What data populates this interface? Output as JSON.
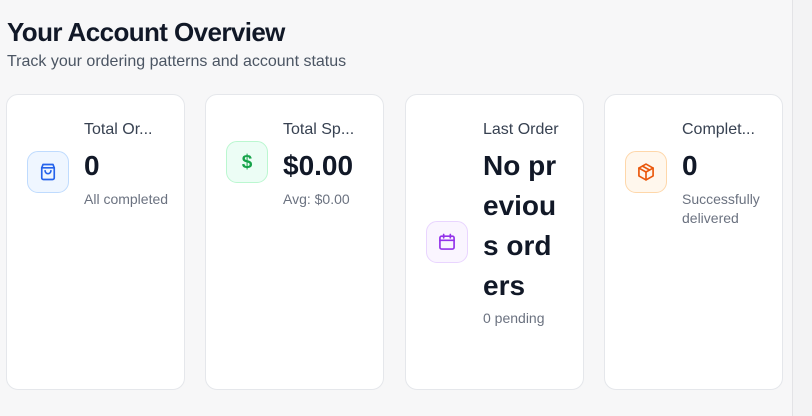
{
  "header": {
    "title": "Your Account Overview",
    "subtitle": "Track your ordering patterns and account status"
  },
  "cards": [
    {
      "icon": "shopping-bag-icon",
      "label": "Total Or...",
      "value": "0",
      "sub": "All completed",
      "accent": "#2563eb"
    },
    {
      "icon": "dollar-icon",
      "label": "Total Sp...",
      "value": "$0.00",
      "sub": "Avg: $0.00",
      "accent": "#16a34a"
    },
    {
      "icon": "calendar-icon",
      "label": "Last Order",
      "value": "No previous orders",
      "sub": "0 pending",
      "accent": "#9333ea"
    },
    {
      "icon": "package-icon",
      "label": "Complet...",
      "value": "0",
      "sub": "Successfully delivered",
      "accent": "#ea580c"
    }
  ]
}
